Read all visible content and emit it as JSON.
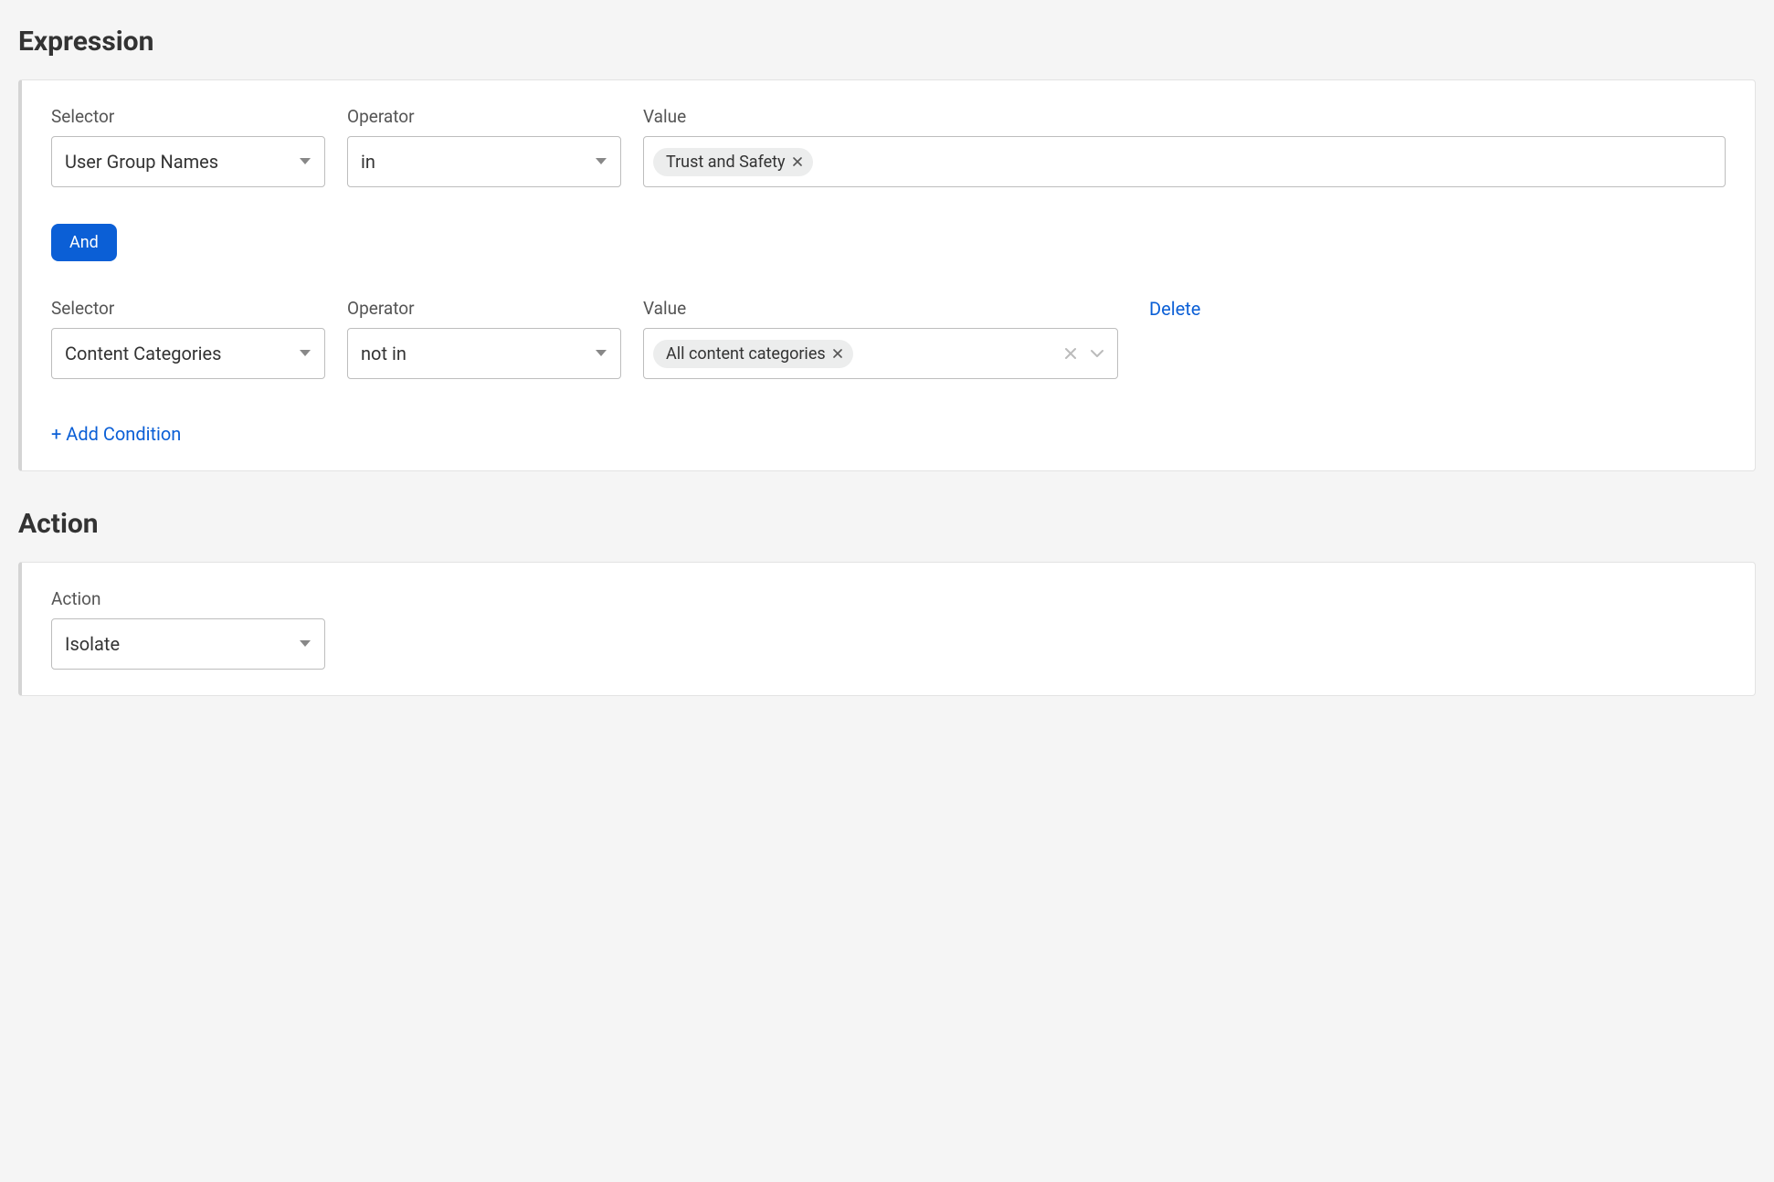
{
  "sections": {
    "expression_title": "Expression",
    "action_title": "Action"
  },
  "labels": {
    "selector": "Selector",
    "operator": "Operator",
    "value": "Value",
    "action": "Action"
  },
  "expression": {
    "conditions": [
      {
        "selector": "User Group Names",
        "operator": "in",
        "tags": [
          "Trust and Safety"
        ],
        "show_combo_controls": false,
        "deletable": false
      },
      {
        "selector": "Content Categories",
        "operator": "not in",
        "tags": [
          "All content categories"
        ],
        "show_combo_controls": true,
        "deletable": true
      }
    ],
    "conjunction": "And",
    "add_condition_label": "+ Add Condition",
    "delete_label": "Delete"
  },
  "action": {
    "value": "Isolate"
  }
}
